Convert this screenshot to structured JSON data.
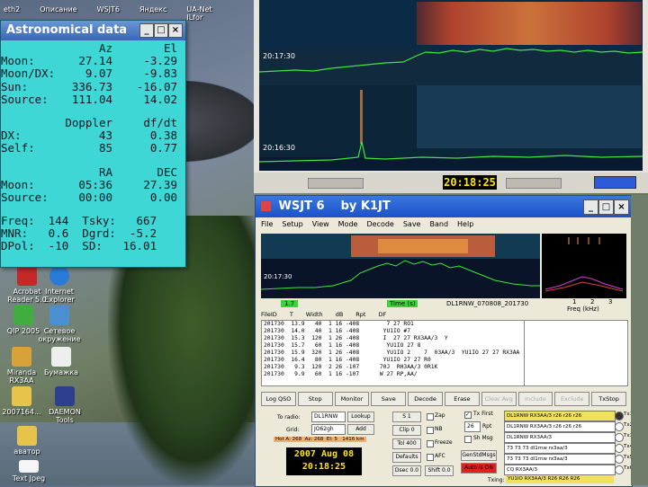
{
  "desktop_icons": [
    {
      "label": "Acrobat\nReader 5.0",
      "icon": "acrobat-icon"
    },
    {
      "label": "Internet\nExplorer",
      "icon": "ie-icon"
    },
    {
      "label": "QIP 2005",
      "icon": "qip-icon"
    },
    {
      "label": "Сетевое\nокружение",
      "icon": "network-icon"
    },
    {
      "label": "Miranda\nRX3AA",
      "icon": "miranda-icon"
    },
    {
      "label": "Бумажка",
      "icon": "notepad-icon"
    },
    {
      "label": "2007164...",
      "icon": "folder-icon"
    },
    {
      "label": "DAEMON\nTools",
      "icon": "daemon-icon"
    },
    {
      "label": "аватор",
      "icon": "folder-icon"
    },
    {
      "label": "Text Jpeg",
      "icon": "doc-icon"
    }
  ],
  "top_icon_labels": [
    "eth2",
    "Описание",
    "WSJT6",
    "Яндекс",
    "UA-Net ILfor"
  ],
  "astro": {
    "title": "Astronomical data",
    "head": {
      "c1": "Az",
      "c2": "El"
    },
    "rows1": [
      {
        "lab": "Moon:",
        "c1": "27.14",
        "c2": "-3.29"
      },
      {
        "lab": "Moon/DX:",
        "c1": "9.07",
        "c2": "-9.83"
      },
      {
        "lab": "Sun:",
        "c1": "336.73",
        "c2": "-16.07"
      },
      {
        "lab": "Source:",
        "c1": "111.04",
        "c2": "14.02"
      }
    ],
    "head2": {
      "c1": "Doppler",
      "c2": "df/dt"
    },
    "rows2": [
      {
        "lab": "DX:",
        "c1": "43",
        "c2": "0.38"
      },
      {
        "lab": "Self:",
        "c1": "85",
        "c2": "0.77"
      }
    ],
    "head3": {
      "c1": "RA",
      "c2": "DEC"
    },
    "rows3": [
      {
        "lab": "Moon:",
        "c1": "05:36",
        "c2": "27.39"
      },
      {
        "lab": "Source:",
        "c1": "00:00",
        "c2": "0.00"
      }
    ],
    "freq": [
      "Freq:  144  Tsky:   667",
      "MNR:   0.6  Dgrd:  -5.2",
      "DPol:  -10  SD:   16.01"
    ]
  },
  "waterfall": {
    "time_a": "20:17:30",
    "time_b": "20:16:30",
    "clock": "20:18:25"
  },
  "wsjt": {
    "title": "WSJT 6    by K1JT",
    "menu": [
      "File",
      "Setup",
      "View",
      "Mode",
      "Decode",
      "Save",
      "Band",
      "Help"
    ],
    "spec_time": "20:17:30",
    "field_a": "1.7",
    "field_b": "Time (s)",
    "file_name": "DL1RNW_070808_201730",
    "freq_label": "Freq (kHz)",
    "freq_ticks": [
      "1",
      "2",
      "3"
    ],
    "col_headers": [
      "FileID",
      "T",
      "Width",
      "dB",
      "Rpt",
      "DF"
    ],
    "decodes": [
      "201730  13.9   40  1 16 -408        7 27 RO1",
      "201730  14.0   40  1 16 -408       YU1IO #7",
      "201730  15.3  120  1 26 -408       I  27 27 RX3AA/3  Y",
      "201730  15.7   60  1 16 -408        YU1IO 27 8",
      "201730  15.9  320  1 26 -408        YU1IO 2    7  03AA/3  YU1IO 27 27 RX3AA",
      "201730  16.4   80  1 16 -408       YU1IO 27 27 R0",
      "201730   9.3  120  2 26 -107      70J  RH3AA/3 0R1K",
      "201730   9.9   60  1 16 -107      W 27 RP,AA/"
    ],
    "buttons": [
      "Log QSO",
      "Stop",
      "Monitor",
      "Save",
      "Decode",
      "Erase",
      "Clear Avg",
      "Include",
      "Exclude",
      "TxStop"
    ],
    "to_radio_label": "To radio:",
    "to_radio": "DL1RNW",
    "grid_label": "Grid:",
    "grid": "JO62gh",
    "lookup": "Lookup",
    "add": "Add",
    "status_line": "Hot A: 268  Az: 268  El: 5   1416 km",
    "date": "2007 Aug 08",
    "time": "20:18:25",
    "s_val": "S   1",
    "clip": "Clip   0",
    "tol": "Tol   400",
    "defaults": "Defaults",
    "dsec": "Dsec  0.0",
    "shift": "Shift  0.0",
    "zap": "Zap",
    "nb": "NB",
    "freeze": "Freeze",
    "afc": "AFC",
    "tx_first": "Tx First",
    "rpt_val": "26",
    "rpt_label": "Rpt",
    "sh_msg": "Sh Msg",
    "r26": "R26",
    "gen_msgs": "GenStdMsgs",
    "auto": "Auto is ON",
    "tx_msgs": [
      "DL1RNW RX3AA/3 r26 r26 r26",
      "DL1RNW RX3AA/3 r26 r26 r26",
      "DL1RNW RX3AA/3",
      "73 73 73 dl1rnw rx3aa/3",
      "73 73 73 dl1rnw rx3aa/3",
      "CQ RX3AA/3"
    ],
    "tx_labels": [
      "Tx1",
      "Tx2",
      "Tx3",
      "Tx4",
      "Tx5",
      "Tx6"
    ],
    "tx_status_label": "Txing:",
    "tx_status": "YU1IO RX3AA/3 R26 R26 R26"
  }
}
